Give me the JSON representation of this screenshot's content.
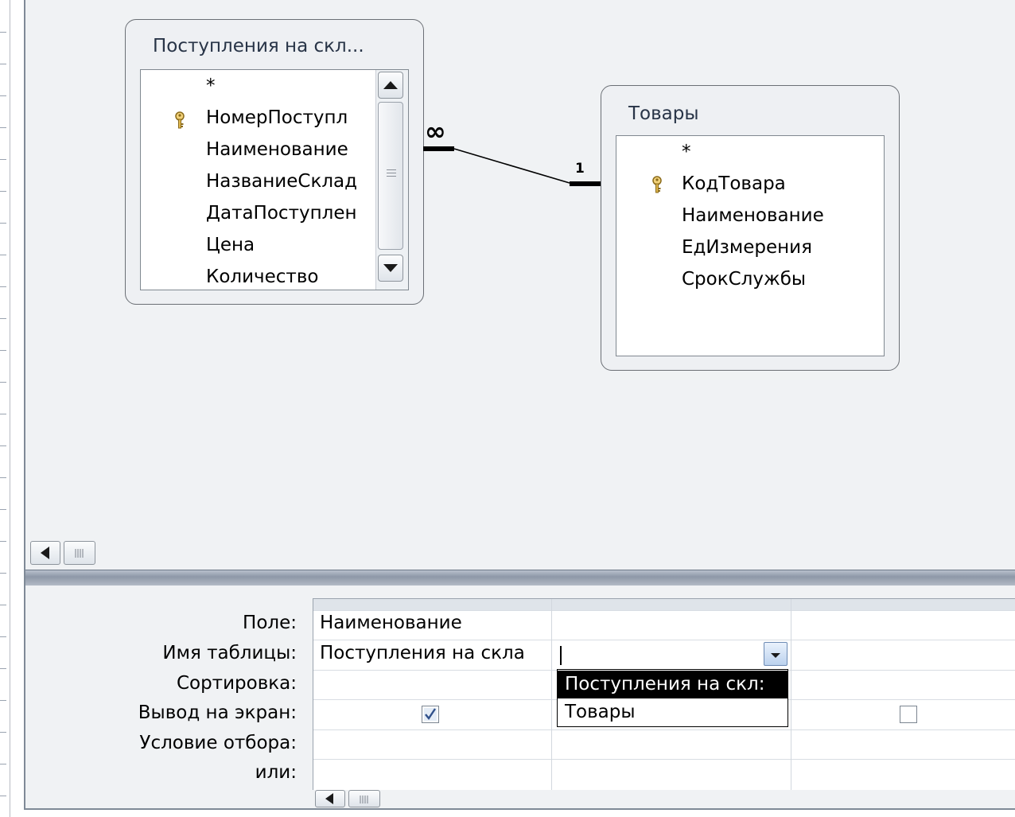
{
  "tables": {
    "left": {
      "title": "Поступления на скл...",
      "fields": [
        "*",
        "НомерПоступл",
        "Наименование",
        "НазваниеСклад",
        "ДатаПоступлен",
        "Цена",
        "Количество"
      ],
      "key_field": "НомерПоступл"
    },
    "right": {
      "title": "Товары",
      "fields": [
        "*",
        "КодТовара",
        "Наименование",
        "ЕдИзмерения",
        "СрокСлужбы"
      ],
      "key_field": "КодТовара"
    }
  },
  "relationship": {
    "many_label": "∞",
    "one_label": "1"
  },
  "grid": {
    "row_labels": [
      "Поле:",
      "Имя таблицы:",
      "Сортировка:",
      "Вывод на экран:",
      "Условие отбора:",
      "или:"
    ],
    "columns": [
      {
        "field": "Наименование",
        "table": "Поступления на скла",
        "show": true
      },
      {
        "field": "",
        "table": "",
        "show": null
      },
      {
        "field": "",
        "table": "",
        "show": false
      }
    ]
  },
  "dropdown": {
    "options": [
      "Поступления на скл:",
      "Товары"
    ],
    "selected_index": 0
  },
  "icons": {
    "key": "primary-key-icon",
    "up": "scroll-up-arrow-icon",
    "down": "scroll-down-arrow-icon",
    "left": "scroll-left-arrow-icon",
    "combo": "chevron-down-icon"
  }
}
